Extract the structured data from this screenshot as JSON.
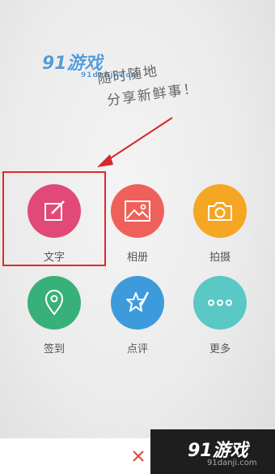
{
  "watermark_top": {
    "brand": "91游戏",
    "sub": "91danji.com"
  },
  "tagline": {
    "line1": "随时随地",
    "line2": "分享新鲜事！"
  },
  "actions": [
    {
      "label": "文字",
      "icon": "edit-icon",
      "color": "#e14a78"
    },
    {
      "label": "相册",
      "icon": "picture-icon",
      "color": "#f0605a"
    },
    {
      "label": "拍摄",
      "icon": "camera-icon",
      "color": "#f5a623"
    },
    {
      "label": "签到",
      "icon": "location-pin-icon",
      "color": "#38b07a"
    },
    {
      "label": "点评",
      "icon": "star-pen-icon",
      "color": "#3d9bdc"
    },
    {
      "label": "更多",
      "icon": "more-dots-icon",
      "color": "#5ac8c4"
    }
  ],
  "close_icon": "close-icon",
  "close_color": "#e0483a",
  "watermark_bottom": {
    "brand": "91游戏",
    "domain": "91danji.com"
  }
}
